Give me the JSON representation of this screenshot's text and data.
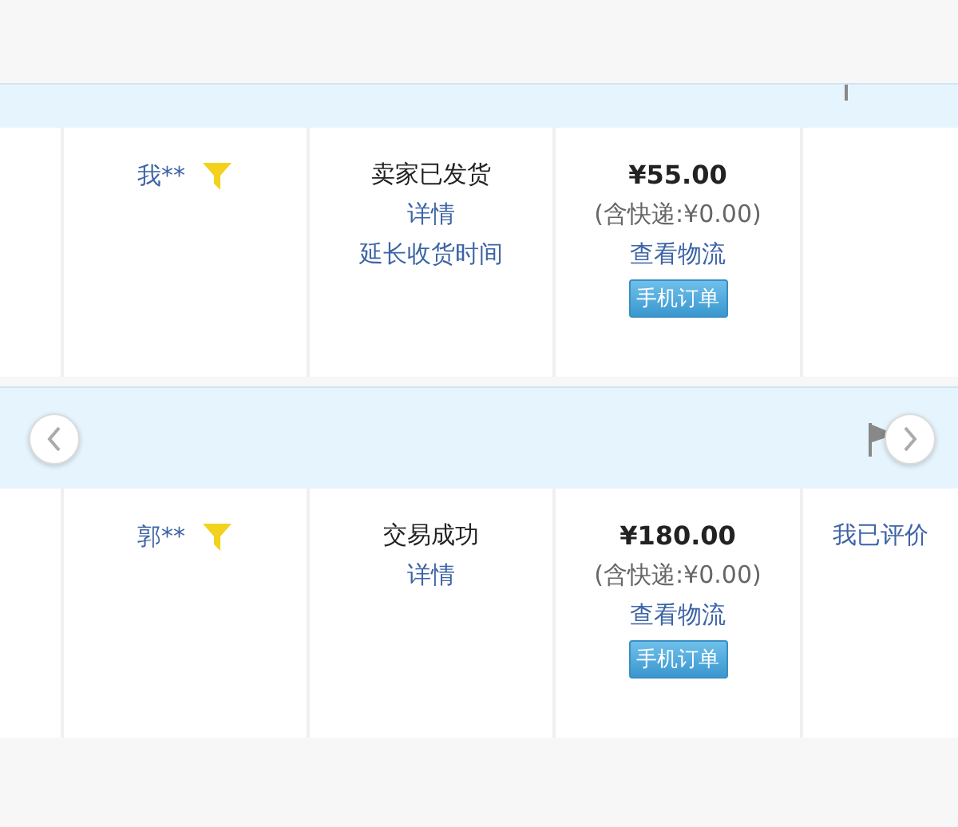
{
  "orders": [
    {
      "nav_buttons": false,
      "buyer": "我**",
      "status": "卖家已发货",
      "actions": [
        "详情",
        "延长收货时间"
      ],
      "price": "¥55.00",
      "shipping": "(含快递:¥0.00)",
      "logistics": "查看物流",
      "badge": "手机订单"
    },
    {
      "nav_buttons": true,
      "buyer": "郭**",
      "status": "交易成功",
      "actions": [
        "详情"
      ],
      "price": "¥180.00",
      "shipping": "(含快递:¥0.00)",
      "logistics": "查看物流",
      "badge": "手机订单",
      "review": "我已评价"
    }
  ]
}
